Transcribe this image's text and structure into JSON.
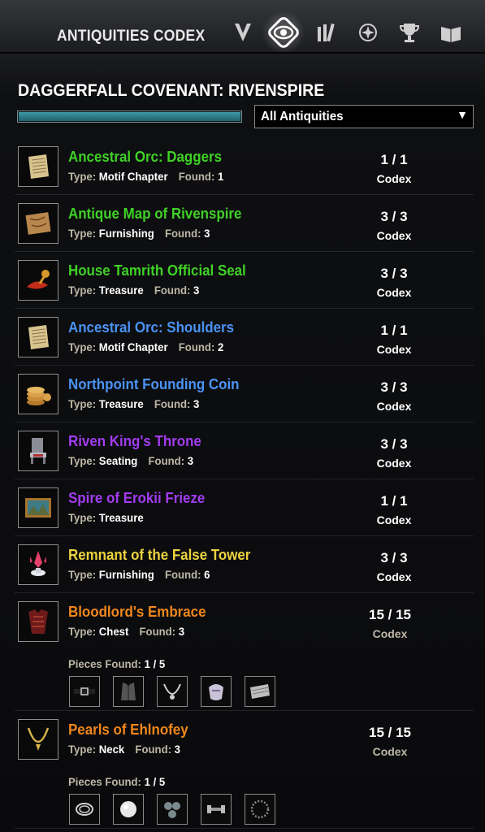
{
  "header": {
    "title": "ANTIQUITIES CODEX",
    "nav_icons": [
      "skills-icon",
      "antiquities-codex-icon",
      "collections-icon",
      "champion-icon",
      "achievements-icon",
      "lore-library-icon"
    ]
  },
  "zone": {
    "title": "DAGGERFALL COVENANT: RIVENSPIRE",
    "progress_fraction": 1.0,
    "progress_color": "#2b7784"
  },
  "filter": {
    "selected": "All Antiquities"
  },
  "colors": {
    "green": "#3fd226",
    "blue": "#4a93f5",
    "purple": "#a23cf0",
    "gold": "#ecd33f",
    "orange": "#f0871c"
  },
  "labels": {
    "type": "Type:",
    "found": "Found:",
    "pieces_found": "Pieces Found:"
  },
  "items": [
    {
      "name": "Ancestral Orc: Daggers",
      "quality": "green",
      "type": "Motif Chapter",
      "found": "1",
      "count": "1 / 1",
      "codex": "Codex",
      "icon": "motif-scroll-icon"
    },
    {
      "name": "Antique Map of Rivenspire",
      "quality": "green",
      "type": "Furnishing",
      "found": "3",
      "count": "3 / 3",
      "codex": "Codex",
      "icon": "map-icon"
    },
    {
      "name": "House Tamrith Official Seal",
      "quality": "green",
      "type": "Treasure",
      "found": "3",
      "count": "3 / 3",
      "codex": "Codex",
      "icon": "seal-icon"
    },
    {
      "name": "Ancestral Orc: Shoulders",
      "quality": "blue",
      "type": "Motif Chapter",
      "found": "2",
      "count": "1 / 1",
      "codex": "Codex",
      "icon": "motif-scroll-icon"
    },
    {
      "name": "Northpoint Founding Coin",
      "quality": "blue",
      "type": "Treasure",
      "found": "3",
      "count": "3 / 3",
      "codex": "Codex",
      "icon": "coins-icon"
    },
    {
      "name": "Riven King's Throne",
      "quality": "purple",
      "type": "Seating",
      "found": "3",
      "count": "3 / 3",
      "codex": "Codex",
      "icon": "throne-icon"
    },
    {
      "name": "Spire of Erokii Frieze",
      "quality": "purple",
      "type": "Treasure",
      "found": "",
      "count": "1 / 1",
      "codex": "Codex",
      "icon": "painting-icon"
    },
    {
      "name": "Remnant of the False Tower",
      "quality": "gold",
      "type": "Furnishing",
      "found": "6",
      "count": "3 / 3",
      "codex": "Codex",
      "icon": "crystal-tower-icon"
    },
    {
      "name": "Bloodlord's Embrace",
      "quality": "orange",
      "type": "Chest",
      "found": "3",
      "count": "15 / 15",
      "codex": "Codex",
      "icon": "armor-chest-icon",
      "pieces_found": "1 / 5",
      "pieces": [
        "belt-piece-icon",
        "vest-piece-icon",
        "necklace-piece-icon",
        "pauldron-piece-icon",
        "cloth-piece-icon"
      ]
    },
    {
      "name": "Pearls of Ehlnofey",
      "quality": "orange",
      "type": "Neck",
      "found": "3",
      "count": "15 / 15",
      "codex": "Codex",
      "icon": "necklace-icon",
      "pieces_found": "1 / 5",
      "pieces": [
        "chain-piece-icon",
        "pearl-piece-icon",
        "pearls-piece-icon",
        "clasp-piece-icon",
        "ring-piece-icon"
      ]
    }
  ]
}
